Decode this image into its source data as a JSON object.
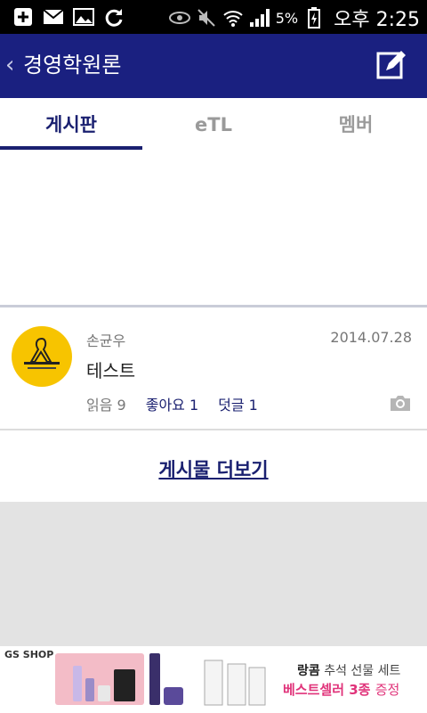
{
  "status_bar": {
    "icons": [
      "plus-box-icon",
      "mail-icon",
      "image-icon",
      "sync-icon",
      "eye-icon",
      "mute-icon",
      "wifi-icon",
      "signal-icon",
      "battery-charging-icon"
    ],
    "battery": "5%",
    "time": "오후 2:25"
  },
  "app_bar": {
    "title": "경영학원론",
    "back_icon": "chevron-left-icon",
    "write_icon": "edit-icon"
  },
  "tabs": [
    {
      "label": "게시판",
      "active": true
    },
    {
      "label": "eTL",
      "active": false
    },
    {
      "label": "멤버",
      "active": false
    }
  ],
  "post": {
    "author": "손균우",
    "date": "2014.07.28",
    "title": "테스트",
    "reads": "읽음 9",
    "likes": "좋아요 1",
    "comments": "덧글 1",
    "attachment_icon": "camera-icon"
  },
  "more_link": "게시물 더보기",
  "ad": {
    "brand": "GS SHOP",
    "headline_brand": "랑콤",
    "headline_rest": "추석 선물 세트",
    "promo_main": "베스트셀러 3종",
    "promo_suffix": "증정",
    "colors": {
      "accent": "#e0337a"
    }
  },
  "colors": {
    "app_bar": "#1a2080",
    "active_tab": "#1a2070",
    "avatar": "#f7c400"
  }
}
